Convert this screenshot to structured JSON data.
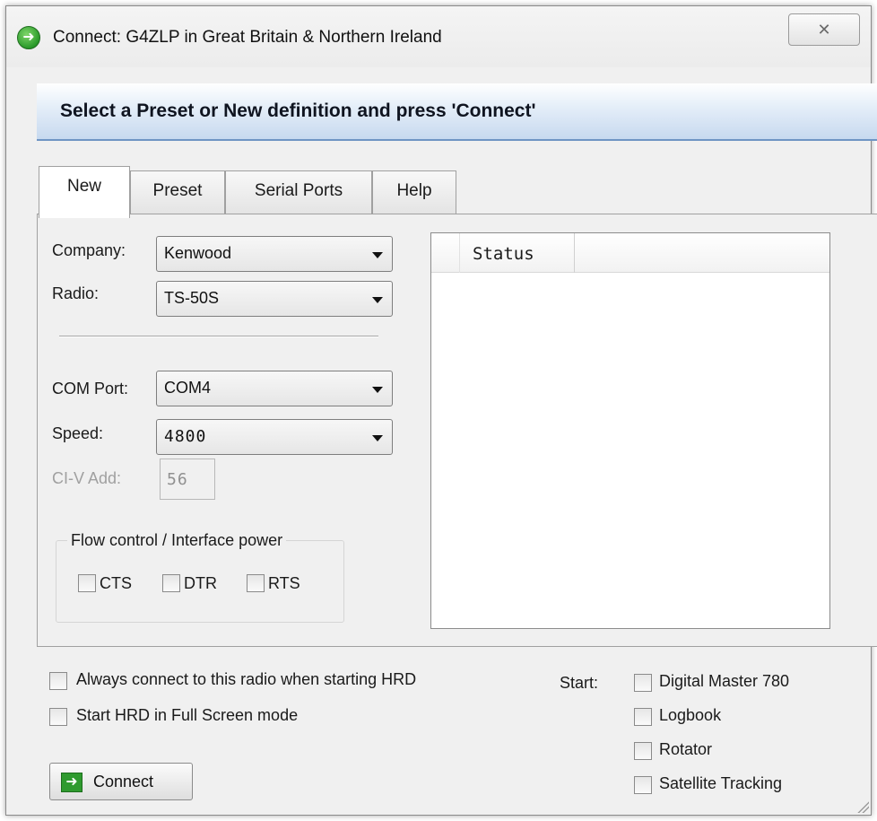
{
  "window": {
    "title": "Connect: G4ZLP in Great Britain & Northern Ireland",
    "close_label": "✕"
  },
  "banner": {
    "text": "Select a Preset or New definition and press 'Connect'"
  },
  "tabs": [
    {
      "label": "New",
      "active": true
    },
    {
      "label": "Preset",
      "active": false
    },
    {
      "label": "Serial Ports",
      "active": false
    },
    {
      "label": "Help",
      "active": false
    }
  ],
  "form": {
    "company": {
      "label": "Company:",
      "value": "Kenwood"
    },
    "radio": {
      "label": "Radio:",
      "value": "TS-50S"
    },
    "com_port": {
      "label": "COM Port:",
      "value": "COM4"
    },
    "speed": {
      "label": "Speed:",
      "value": "4800"
    },
    "civ_address": {
      "label": "CI-V Add:",
      "value": "56",
      "disabled": true
    },
    "flow_control": {
      "title": "Flow control / Interface power",
      "options": [
        {
          "label": "CTS",
          "checked": false
        },
        {
          "label": "DTR",
          "checked": false
        },
        {
          "label": "RTS",
          "checked": false
        }
      ]
    }
  },
  "status_list": {
    "column_header": "Status",
    "rows": []
  },
  "options": {
    "always_connect": {
      "label": "Always connect to this radio when starting HRD",
      "checked": false
    },
    "full_screen": {
      "label": "Start HRD in Full Screen mode",
      "checked": false
    }
  },
  "start": {
    "label": "Start:",
    "items": [
      {
        "label": "Digital Master 780",
        "checked": false
      },
      {
        "label": "Logbook",
        "checked": false
      },
      {
        "label": "Rotator",
        "checked": false
      },
      {
        "label": "Satellite Tracking",
        "checked": false
      }
    ]
  },
  "connect_button": {
    "label": "Connect",
    "icon": "green-arrow-icon"
  },
  "colors": {
    "banner_start": "#ffffff",
    "banner_end": "#c7d9ef",
    "banner_border": "#6f95c4",
    "window_bg": "#f0f0f0",
    "accent_green": "#2f9a2f"
  }
}
